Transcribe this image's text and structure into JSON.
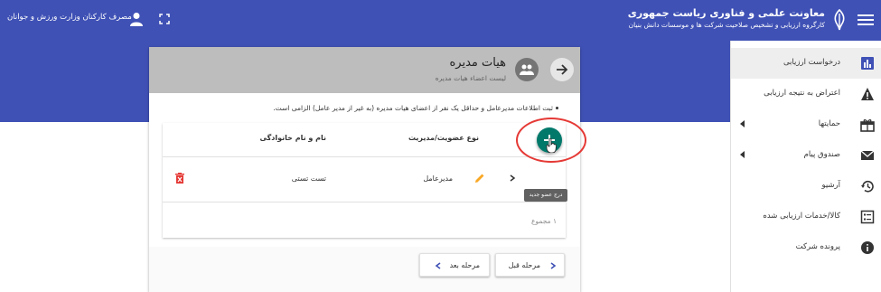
{
  "header": {
    "title": "معاونت علمی و فناوری ریاست جمهوری",
    "subtitle": "کارگروه ارزیابی و تشخیص صلاحیت شرکت ها و موسسات دانش بنیان",
    "user_name": "مصرف کارکنان وزارت ورزش و جوانان",
    "colors": {
      "primary": "#3f51b5"
    }
  },
  "sidebar": {
    "items": [
      {
        "label": "درخواست ارزیابی",
        "icon": "bar-chart-icon",
        "active": true
      },
      {
        "label": "اعتراض به نتیجه ارزیابی",
        "icon": "warning-icon"
      },
      {
        "label": "حمایتها",
        "icon": "gift-icon",
        "expandable": true
      },
      {
        "label": "صندوق پیام",
        "icon": "mail-icon",
        "expandable": true
      },
      {
        "label": "آرشیو",
        "icon": "history-icon"
      },
      {
        "label": "کالا/خدمات ارزیابی شده",
        "icon": "list-icon"
      },
      {
        "label": "پرونده شرکت",
        "icon": "info-icon"
      }
    ]
  },
  "card": {
    "title": "هیات مدیره",
    "subtitle": "لیست اعضاء هیات مدیره",
    "notice": "ثبت اطلاعات مدیرعامل و حداقل یک نفر از اعضای هیات مدیره (به غیر از مدیر عامل) الزامی است.",
    "table": {
      "columns": [
        "نوع عضویت/مدیریت",
        "نام و نام خانوادگی"
      ],
      "rows": [
        {
          "role": "مدیرعامل",
          "name": "تست تستی"
        }
      ],
      "total": "۱ مجموع"
    },
    "add_tooltip": "درج عضو جدید",
    "prev_label": "مرحله قبل",
    "next_label": "مرحله بعد",
    "colors": {
      "fab": "#00796b",
      "highlight": "#e53935",
      "delete": "#e53935",
      "edit": "#f9a825"
    }
  }
}
